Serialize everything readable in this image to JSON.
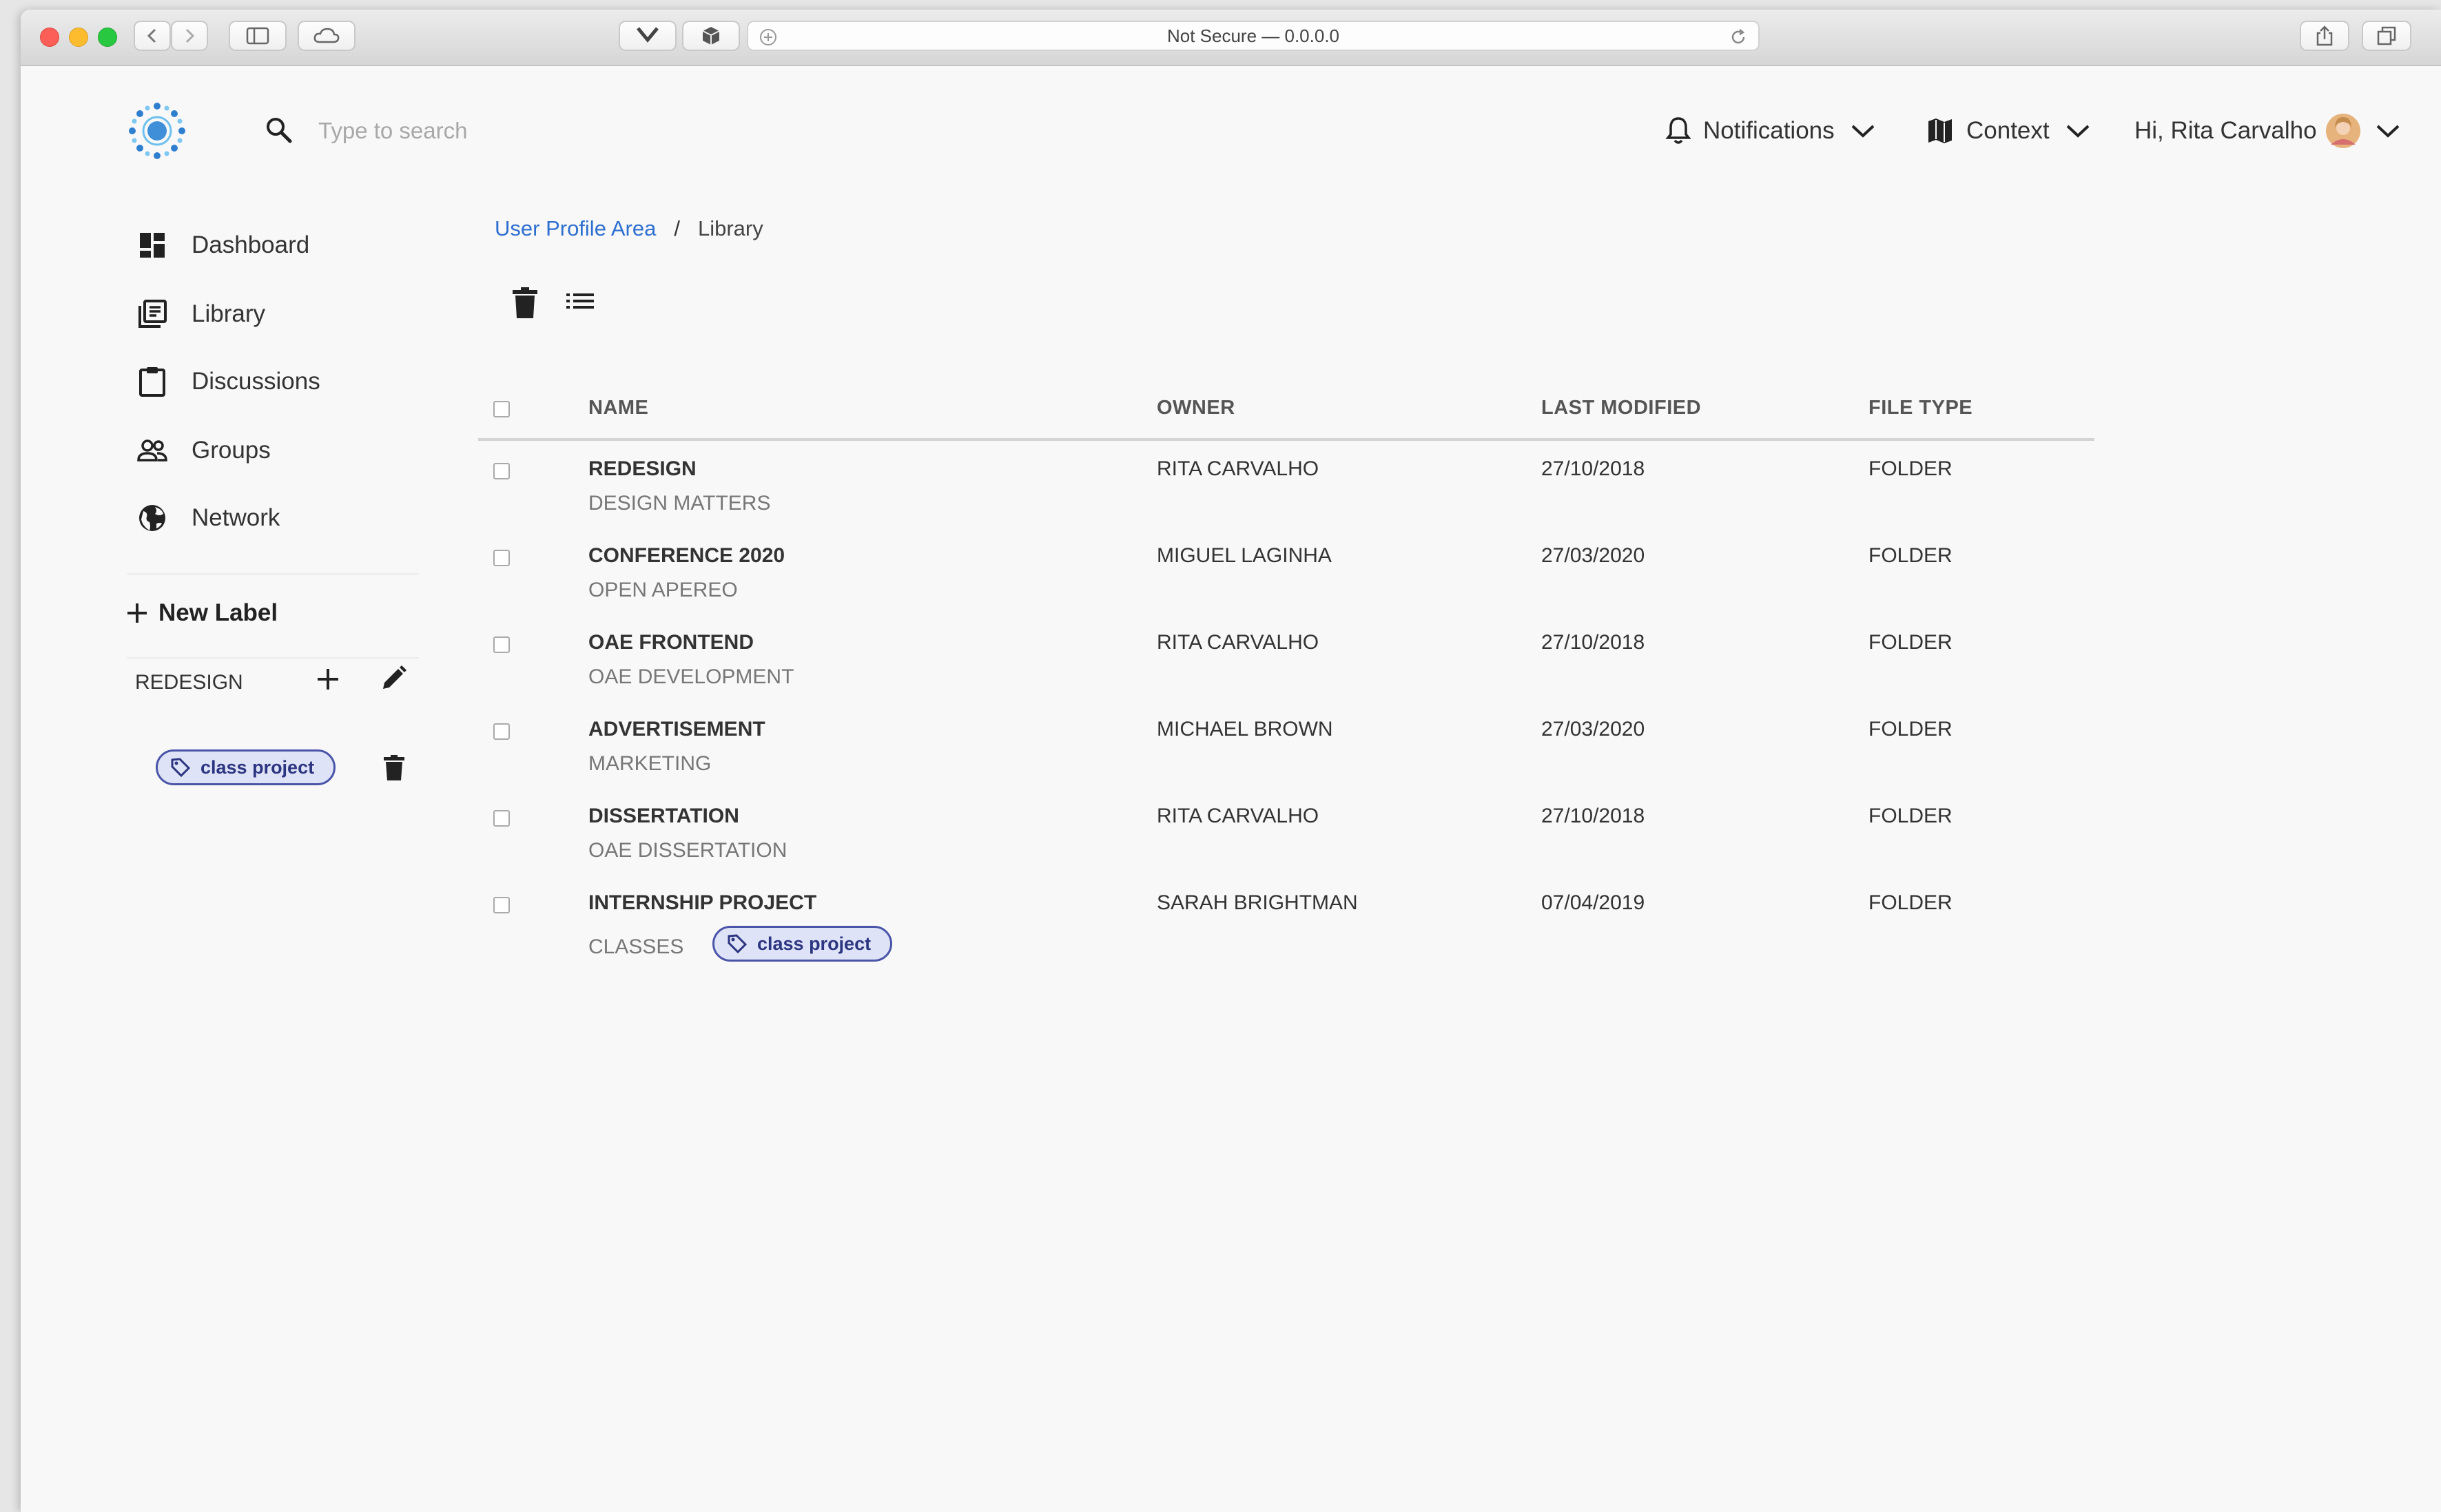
{
  "browser": {
    "url_text": "Not Secure — 0.0.0.0"
  },
  "search": {
    "placeholder": "Type to search"
  },
  "topnav": {
    "notifications_label": "Notifications",
    "context_label": "Context",
    "user_greeting": "Hi, Rita Carvalho"
  },
  "sidebar": {
    "items": [
      {
        "label": "Dashboard",
        "icon": "dashboard-icon"
      },
      {
        "label": "Library",
        "icon": "library-icon"
      },
      {
        "label": "Discussions",
        "icon": "clipboard-icon"
      },
      {
        "label": "Groups",
        "icon": "groups-icon"
      },
      {
        "label": "Network",
        "icon": "globe-icon"
      }
    ],
    "new_label": "New Label",
    "label_group": {
      "name": "REDESIGN",
      "tag": "class project"
    }
  },
  "breadcrumb": {
    "parent": "User Profile Area",
    "separator": "/",
    "current": "Library"
  },
  "table": {
    "columns": [
      "NAME",
      "OWNER",
      "LAST MODIFIED",
      "FILE TYPE"
    ],
    "rows": [
      {
        "name": "REDESIGN",
        "subtitle": "DESIGN MATTERS",
        "owner": "RITA CARVALHO",
        "modified": "27/10/2018",
        "type": "FOLDER"
      },
      {
        "name": "CONFERENCE 2020",
        "subtitle": "OPEN APEREO",
        "owner": "MIGUEL LAGINHA",
        "modified": "27/03/2020",
        "type": "FOLDER"
      },
      {
        "name": "OAE FRONTEND",
        "subtitle": "OAE DEVELOPMENT",
        "owner": "RITA CARVALHO",
        "modified": "27/10/2018",
        "type": "FOLDER"
      },
      {
        "name": "ADVERTISEMENT",
        "subtitle": "MARKETING",
        "owner": "MICHAEL BROWN",
        "modified": "27/03/2020",
        "type": "FOLDER"
      },
      {
        "name": "DISSERTATION",
        "subtitle": "OAE DISSERTATION",
        "owner": "RITA CARVALHO",
        "modified": "27/10/2018",
        "type": "FOLDER"
      },
      {
        "name": "INTERNSHIP PROJECT",
        "subtitle": "CLASSES",
        "tag": "class project",
        "owner": "SARAH BRIGHTMAN",
        "modified": "07/04/2019",
        "type": "FOLDER"
      }
    ]
  },
  "colors": {
    "accent": "#2e6fd0",
    "tag_border": "#4a55a8",
    "tag_fill": "#dfe3f7"
  }
}
